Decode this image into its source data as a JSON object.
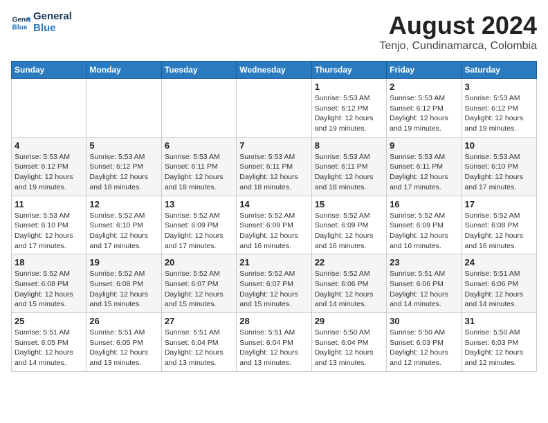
{
  "logo": {
    "line1": "General",
    "line2": "Blue"
  },
  "title": "August 2024",
  "subtitle": "Tenjo, Cundinamarca, Colombia",
  "days_of_week": [
    "Sunday",
    "Monday",
    "Tuesday",
    "Wednesday",
    "Thursday",
    "Friday",
    "Saturday"
  ],
  "weeks": [
    [
      {
        "day": "",
        "info": ""
      },
      {
        "day": "",
        "info": ""
      },
      {
        "day": "",
        "info": ""
      },
      {
        "day": "",
        "info": ""
      },
      {
        "day": "1",
        "info": "Sunrise: 5:53 AM\nSunset: 6:12 PM\nDaylight: 12 hours\nand 19 minutes."
      },
      {
        "day": "2",
        "info": "Sunrise: 5:53 AM\nSunset: 6:12 PM\nDaylight: 12 hours\nand 19 minutes."
      },
      {
        "day": "3",
        "info": "Sunrise: 5:53 AM\nSunset: 6:12 PM\nDaylight: 12 hours\nand 19 minutes."
      }
    ],
    [
      {
        "day": "4",
        "info": "Sunrise: 5:53 AM\nSunset: 6:12 PM\nDaylight: 12 hours\nand 19 minutes."
      },
      {
        "day": "5",
        "info": "Sunrise: 5:53 AM\nSunset: 6:12 PM\nDaylight: 12 hours\nand 18 minutes."
      },
      {
        "day": "6",
        "info": "Sunrise: 5:53 AM\nSunset: 6:11 PM\nDaylight: 12 hours\nand 18 minutes."
      },
      {
        "day": "7",
        "info": "Sunrise: 5:53 AM\nSunset: 6:11 PM\nDaylight: 12 hours\nand 18 minutes."
      },
      {
        "day": "8",
        "info": "Sunrise: 5:53 AM\nSunset: 6:11 PM\nDaylight: 12 hours\nand 18 minutes."
      },
      {
        "day": "9",
        "info": "Sunrise: 5:53 AM\nSunset: 6:11 PM\nDaylight: 12 hours\nand 17 minutes."
      },
      {
        "day": "10",
        "info": "Sunrise: 5:53 AM\nSunset: 6:10 PM\nDaylight: 12 hours\nand 17 minutes."
      }
    ],
    [
      {
        "day": "11",
        "info": "Sunrise: 5:53 AM\nSunset: 6:10 PM\nDaylight: 12 hours\nand 17 minutes."
      },
      {
        "day": "12",
        "info": "Sunrise: 5:52 AM\nSunset: 6:10 PM\nDaylight: 12 hours\nand 17 minutes."
      },
      {
        "day": "13",
        "info": "Sunrise: 5:52 AM\nSunset: 6:09 PM\nDaylight: 12 hours\nand 17 minutes."
      },
      {
        "day": "14",
        "info": "Sunrise: 5:52 AM\nSunset: 6:09 PM\nDaylight: 12 hours\nand 16 minutes."
      },
      {
        "day": "15",
        "info": "Sunrise: 5:52 AM\nSunset: 6:09 PM\nDaylight: 12 hours\nand 16 minutes."
      },
      {
        "day": "16",
        "info": "Sunrise: 5:52 AM\nSunset: 6:09 PM\nDaylight: 12 hours\nand 16 minutes."
      },
      {
        "day": "17",
        "info": "Sunrise: 5:52 AM\nSunset: 6:08 PM\nDaylight: 12 hours\nand 16 minutes."
      }
    ],
    [
      {
        "day": "18",
        "info": "Sunrise: 5:52 AM\nSunset: 6:08 PM\nDaylight: 12 hours\nand 15 minutes."
      },
      {
        "day": "19",
        "info": "Sunrise: 5:52 AM\nSunset: 6:08 PM\nDaylight: 12 hours\nand 15 minutes."
      },
      {
        "day": "20",
        "info": "Sunrise: 5:52 AM\nSunset: 6:07 PM\nDaylight: 12 hours\nand 15 minutes."
      },
      {
        "day": "21",
        "info": "Sunrise: 5:52 AM\nSunset: 6:07 PM\nDaylight: 12 hours\nand 15 minutes."
      },
      {
        "day": "22",
        "info": "Sunrise: 5:52 AM\nSunset: 6:06 PM\nDaylight: 12 hours\nand 14 minutes."
      },
      {
        "day": "23",
        "info": "Sunrise: 5:51 AM\nSunset: 6:06 PM\nDaylight: 12 hours\nand 14 minutes."
      },
      {
        "day": "24",
        "info": "Sunrise: 5:51 AM\nSunset: 6:06 PM\nDaylight: 12 hours\nand 14 minutes."
      }
    ],
    [
      {
        "day": "25",
        "info": "Sunrise: 5:51 AM\nSunset: 6:05 PM\nDaylight: 12 hours\nand 14 minutes."
      },
      {
        "day": "26",
        "info": "Sunrise: 5:51 AM\nSunset: 6:05 PM\nDaylight: 12 hours\nand 13 minutes."
      },
      {
        "day": "27",
        "info": "Sunrise: 5:51 AM\nSunset: 6:04 PM\nDaylight: 12 hours\nand 13 minutes."
      },
      {
        "day": "28",
        "info": "Sunrise: 5:51 AM\nSunset: 6:04 PM\nDaylight: 12 hours\nand 13 minutes."
      },
      {
        "day": "29",
        "info": "Sunrise: 5:50 AM\nSunset: 6:04 PM\nDaylight: 12 hours\nand 13 minutes."
      },
      {
        "day": "30",
        "info": "Sunrise: 5:50 AM\nSunset: 6:03 PM\nDaylight: 12 hours\nand 12 minutes."
      },
      {
        "day": "31",
        "info": "Sunrise: 5:50 AM\nSunset: 6:03 PM\nDaylight: 12 hours\nand 12 minutes."
      }
    ]
  ]
}
